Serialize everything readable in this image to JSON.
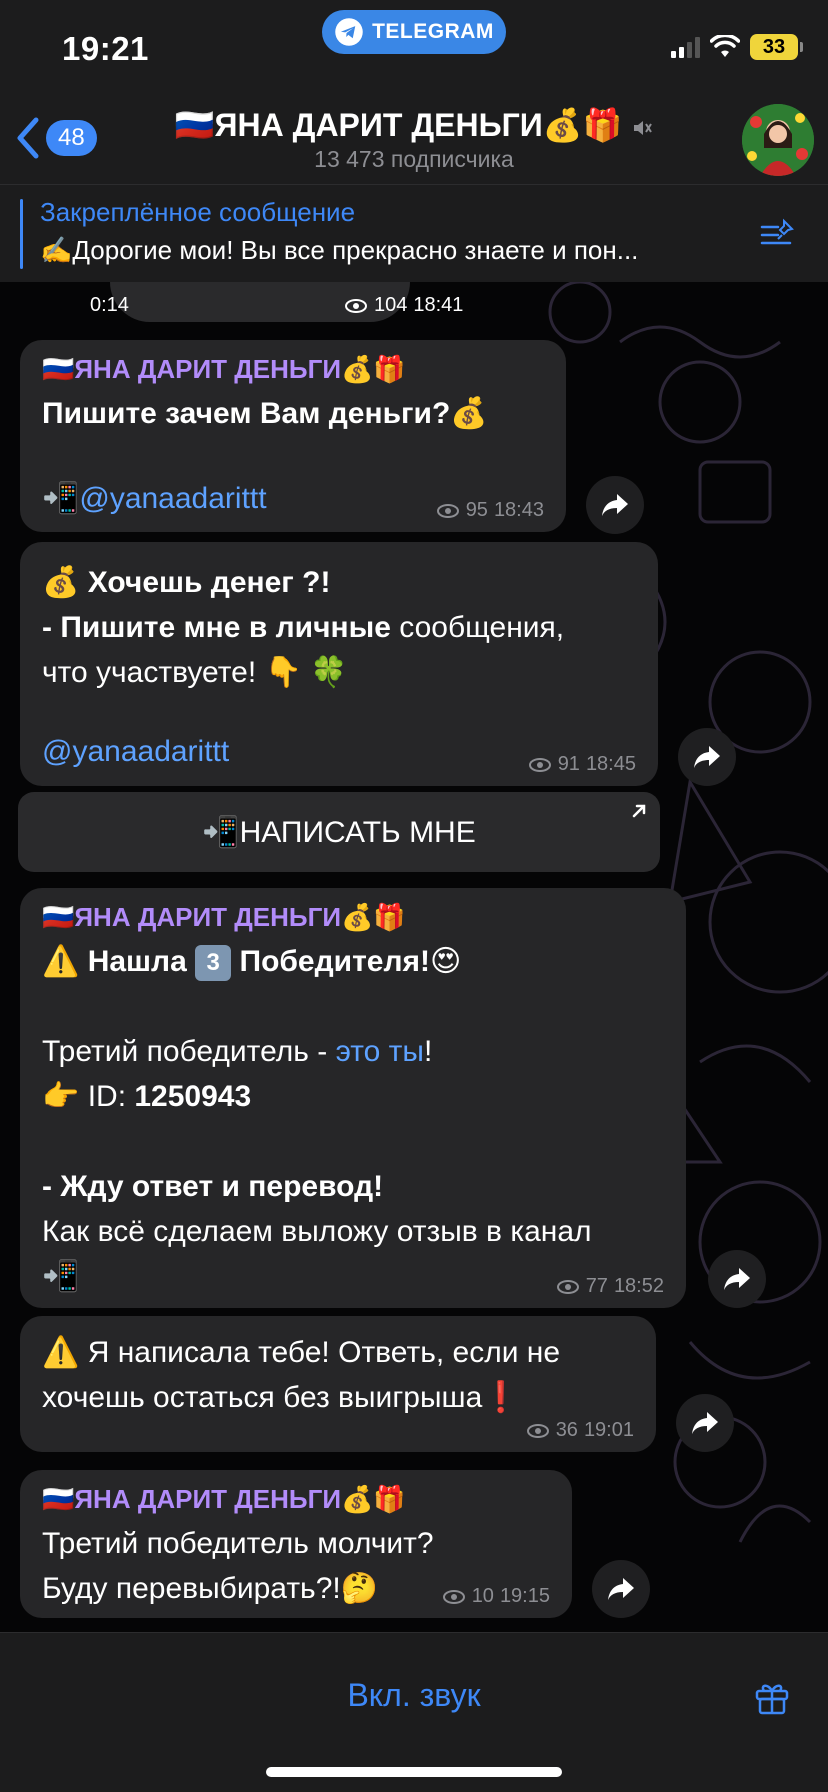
{
  "status_bar": {
    "time": "19:21",
    "app_pill": "TELEGRAM",
    "battery": "33"
  },
  "header": {
    "back_count": "48",
    "title": "🇷🇺ЯНА ДАРИТ ДЕНЬГИ💰🎁",
    "subscribers": "13 473 подписчика"
  },
  "pinned": {
    "title": "Закреплённое сообщение",
    "text": "✍️Дорогие мои! Вы все прекрасно знаете и пон..."
  },
  "video": {
    "duration": "0:14",
    "views": "104",
    "time": "18:41"
  },
  "messages": [
    {
      "sender": "🇷🇺ЯНА ДАРИТ ДЕНЬГИ💰🎁",
      "line1": "Пишите зачем Вам деньги?💰",
      "line2_icon": "📲",
      "line2_link": "@yanaadarittt",
      "views": "95",
      "time": "18:43"
    },
    {
      "line1_emoji": "💰",
      "line1": "Хочешь денег ?!",
      "line2_bold": "- Пишите мне в личные",
      "line2_rest": " сообщения,",
      "line3": "что участвуете! 👇 🍀",
      "link": "@yanaadarittt",
      "views": "91",
      "time": "18:45"
    },
    {
      "sender": "🇷🇺ЯНА ДАРИТ ДЕНЬГИ💰🎁",
      "line1_prefix": "⚠️",
      "line1_a": "Нашла",
      "line1_num": "3",
      "line1_b": "Победителя!😍",
      "line2_a": "Третий победитель - ",
      "line2_link": "это ты",
      "line2_b": "!",
      "line3_icon": "👉",
      "line3_label": " ID:  ",
      "line3_id": "1250943",
      "line4": "- Жду ответ и перевод!",
      "line5": "Как всё сделаем выложу отзыв в канал",
      "line6": "📲",
      "views": "77",
      "time": "18:52"
    },
    {
      "line1": "⚠️ Я написала тебе! Ответь, если не",
      "line2": "хочешь остаться без выигрыша❗",
      "views": "36",
      "time": "19:01"
    },
    {
      "sender": "🇷🇺ЯНА ДАРИТ ДЕНЬГИ💰🎁",
      "line1": "Третий победитель молчит?",
      "line2": "Буду перевыбирать?!🤔",
      "views": "10",
      "time": "19:15"
    }
  ],
  "inline_button": {
    "label": "📲НАПИСАТЬ МНЕ"
  },
  "bottom_bar": {
    "sound_label": "Вкл. звук"
  }
}
